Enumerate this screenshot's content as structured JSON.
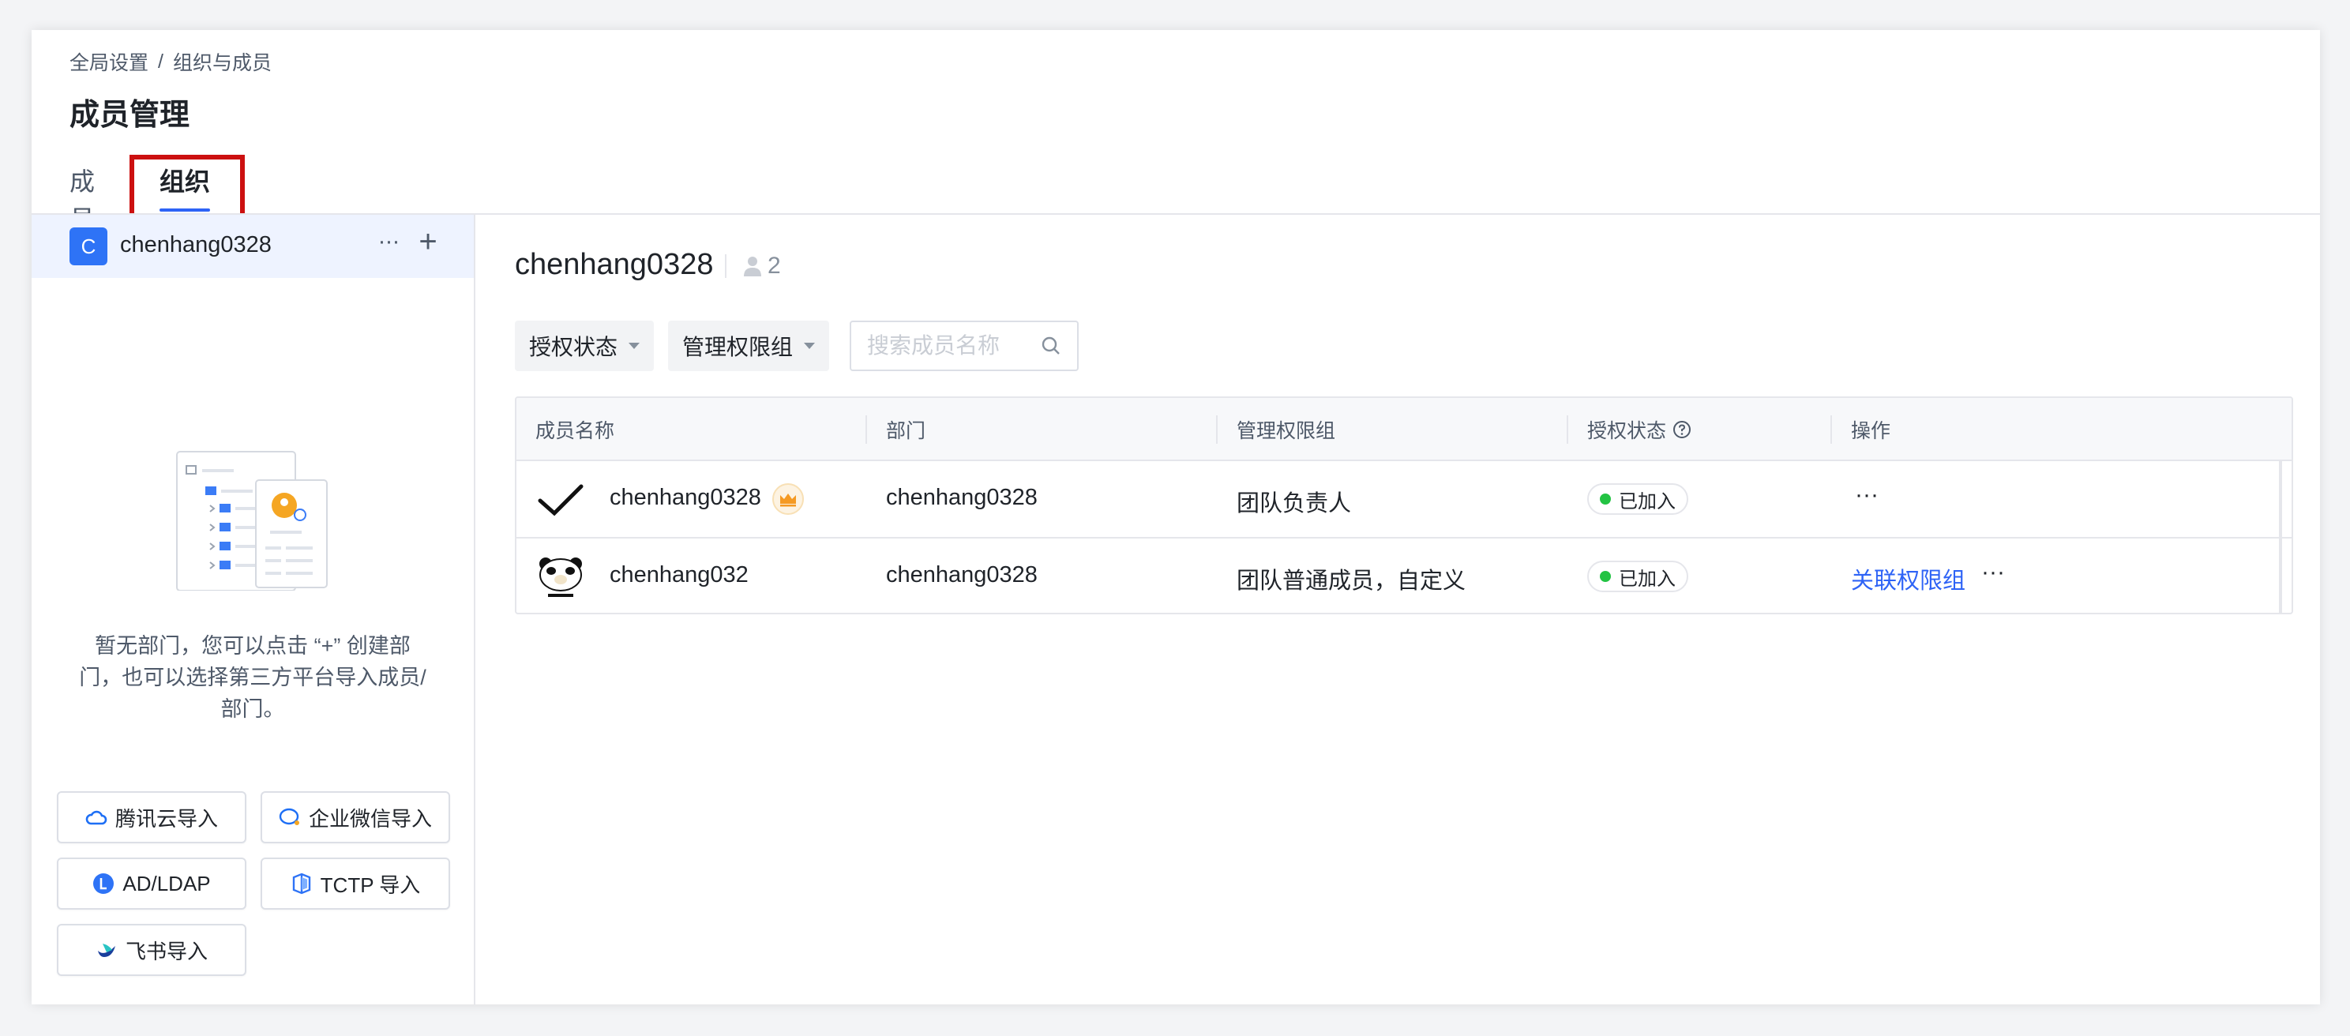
{
  "breadcrumb": {
    "root": "全局设置",
    "separator": "/",
    "current": "组织与成员"
  },
  "page_title": "成员管理",
  "tabs": [
    {
      "label": "成员"
    },
    {
      "label": "组织"
    }
  ],
  "sidebar": {
    "org": {
      "avatar_letter": "C",
      "name": "chenhang0328",
      "more": "···",
      "add": "+"
    },
    "empty_text": "暂无部门，您可以点击 “+” 创建部门，也可以选择第三方平台导入成员/部门。",
    "import_buttons": [
      {
        "label": "腾讯云导入",
        "icon": "tencent-cloud-icon"
      },
      {
        "label": "企业微信导入",
        "icon": "wecom-icon"
      },
      {
        "label": "AD/LDAP",
        "icon": "ldap-icon"
      },
      {
        "label": "TCTP 导入",
        "icon": "tctp-icon"
      },
      {
        "label": "飞书导入",
        "icon": "feishu-icon"
      }
    ]
  },
  "main": {
    "group_title": "chenhang0328",
    "member_count": "2",
    "filters": {
      "auth_status": "授权状态",
      "permission_group": "管理权限组"
    },
    "search": {
      "placeholder": "搜索成员名称",
      "value": ""
    },
    "table": {
      "columns": [
        "成员名称",
        "部门",
        "管理权限组",
        "授权状态",
        "操作"
      ],
      "rows": [
        {
          "name": "chenhang0328",
          "dept": "chenhang0328",
          "group": "团队负责人",
          "status": "已加入",
          "link": "",
          "more": "···"
        },
        {
          "name": "chenhang032",
          "dept": "chenhang0328",
          "group": "团队普通成员，自定义",
          "status": "已加入",
          "link": "关联权限组",
          "more": "···"
        }
      ]
    }
  },
  "colors": {
    "accent": "#2e63f6",
    "highlight": "#cc1010",
    "status_green": "#23c343",
    "crown": "#f59a23"
  }
}
